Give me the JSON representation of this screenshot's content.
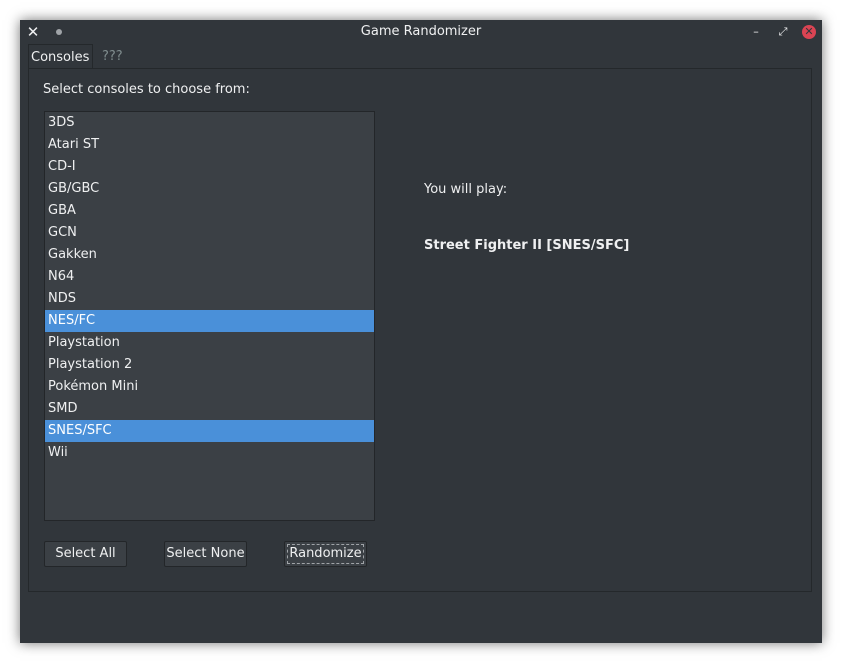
{
  "window": {
    "title": "Game Randomizer",
    "close_glyph": "✕",
    "minimize_glyph": "–",
    "maximize_glyph": "⤢",
    "close_button_glyph": "✕"
  },
  "tabs": [
    {
      "label": "Consoles",
      "active": true
    },
    {
      "label": "???",
      "active": false
    }
  ],
  "consoles": {
    "prompt": "Select consoles to choose from:",
    "items": [
      {
        "label": "3DS",
        "selected": false
      },
      {
        "label": "Atari ST",
        "selected": false
      },
      {
        "label": "CD-I",
        "selected": false
      },
      {
        "label": "GB/GBC",
        "selected": false
      },
      {
        "label": "GBA",
        "selected": false
      },
      {
        "label": "GCN",
        "selected": false
      },
      {
        "label": "Gakken",
        "selected": false
      },
      {
        "label": "N64",
        "selected": false
      },
      {
        "label": "NDS",
        "selected": false
      },
      {
        "label": "NES/FC",
        "selected": true
      },
      {
        "label": "Playstation",
        "selected": false
      },
      {
        "label": "Playstation 2",
        "selected": false
      },
      {
        "label": "Pokémon Mini",
        "selected": false
      },
      {
        "label": "SMD",
        "selected": false
      },
      {
        "label": "SNES/SFC",
        "selected": true
      },
      {
        "label": "Wii",
        "selected": false
      }
    ]
  },
  "buttons": {
    "select_all": "Select All",
    "select_none": "Select None",
    "randomize": "Randomize"
  },
  "result": {
    "label": "You will play:",
    "game": "Street Fighter II [SNES/SFC]"
  },
  "colors": {
    "window_bg": "#31363b",
    "list_bg": "#3b4045",
    "selection": "#4a90d9",
    "close_button": "#da4453"
  }
}
